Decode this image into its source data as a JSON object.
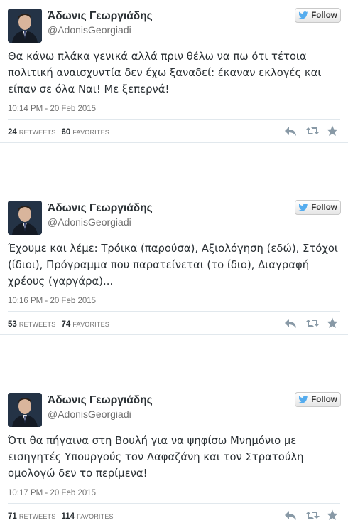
{
  "tweets": [
    {
      "name": "Άδωνις Γεωργιάδης",
      "handle": "@AdonisGeorgiadi",
      "follow_label": "Follow",
      "text": "Θα κάνω πλάκα γενικά αλλά πριν θέλω να πω ότι τέτοια πολιτική αναισχυντία δεν έχω ξαναδεί: έκαναν εκλογές και είπαν σε όλα Ναι! Με ξεπερνά!",
      "timestamp": "10:14 PM - 20 Feb 2015",
      "retweets": "24",
      "retweets_label": "RETWEETS",
      "favorites": "60",
      "favorites_label": "FAVORITES"
    },
    {
      "name": "Άδωνις Γεωργιάδης",
      "handle": "@AdonisGeorgiadi",
      "follow_label": "Follow",
      "text": "Έχουμε και λέμε: Τρόικα (παρούσα), Αξιολόγηση (εδώ), Στόχοι (ίδιοι), Πρόγραμμα που παρατείνεται (το ίδιο), Διαγραφή χρέους (γαργάρα)...",
      "timestamp": "10:16 PM - 20 Feb 2015",
      "retweets": "53",
      "retweets_label": "RETWEETS",
      "favorites": "74",
      "favorites_label": "FAVORITES"
    },
    {
      "name": "Άδωνις Γεωργιάδης",
      "handle": "@AdonisGeorgiadi",
      "follow_label": "Follow",
      "text": "Ότι θα πήγαινα στη Βουλή για να ψηφίσω Μνημόνιο με εισηγητές Υπουργούς τον Λαφαζάνη και τον Στρατούλη ομολογώ δεν το περίμενα!",
      "timestamp": "10:17 PM - 20 Feb 2015",
      "retweets": "71",
      "retweets_label": "RETWEETS",
      "favorites": "114",
      "favorites_label": "FAVORITES"
    }
  ],
  "icons": {
    "follow": "twitter-bird-icon",
    "reply": "reply-icon",
    "retweet": "retweet-icon",
    "favorite": "star-icon"
  },
  "colors": {
    "twitter_blue": "#55acee",
    "icon_gray": "#8899a6",
    "text": "#292f33",
    "meta": "#707070"
  }
}
